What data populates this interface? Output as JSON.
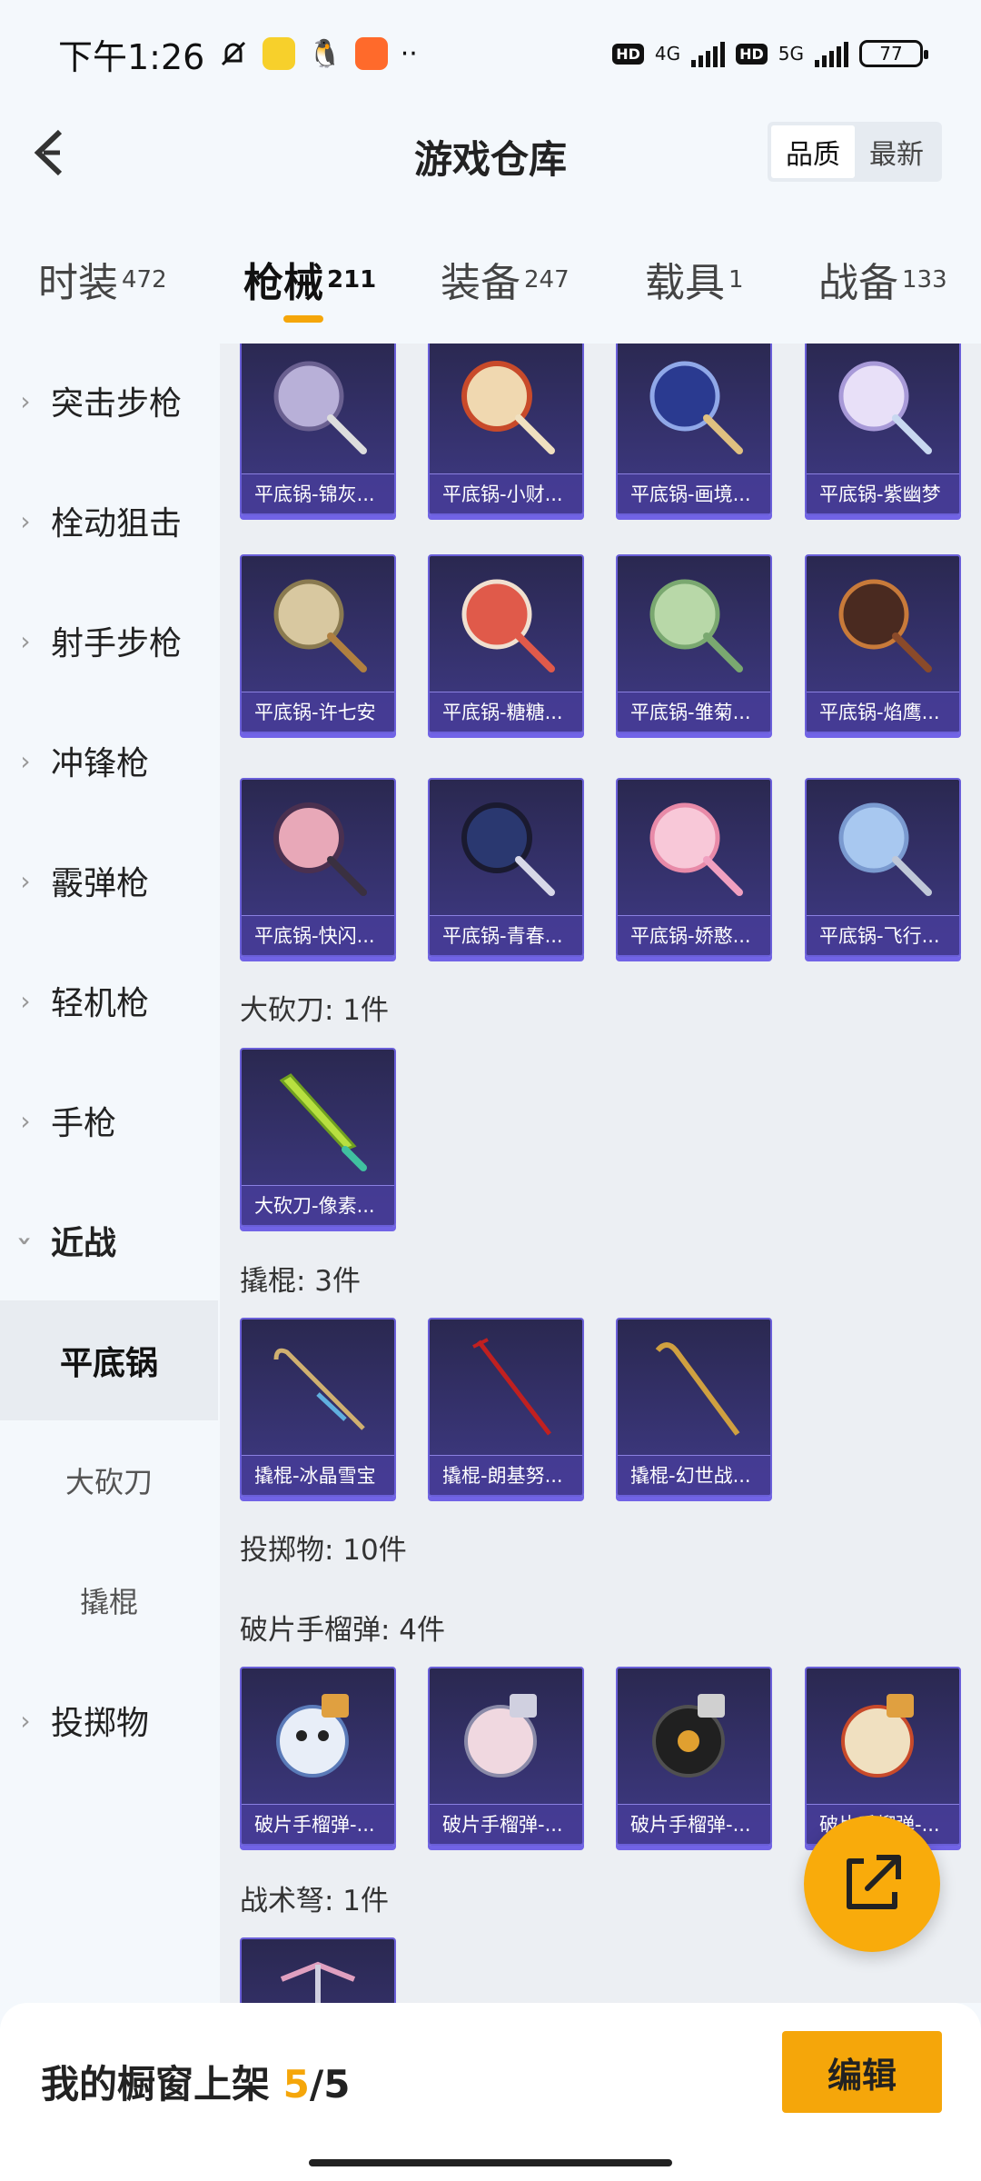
{
  "status_bar": {
    "time": "下午1:26",
    "net1": "4G",
    "net2": "5G",
    "hd": "HD",
    "battery": "77"
  },
  "header": {
    "title": "游戏仓库",
    "sort_quality": "品质",
    "sort_latest": "最新"
  },
  "tabs": [
    {
      "label": "时装",
      "count": "472"
    },
    {
      "label": "枪械",
      "count": "211"
    },
    {
      "label": "装备",
      "count": "247"
    },
    {
      "label": "载具",
      "count": "1"
    },
    {
      "label": "战备",
      "count": "133"
    }
  ],
  "sidebar": {
    "cat1": "突击步枪",
    "cat2": "栓动狙击",
    "cat3": "射手步枪",
    "cat4": "冲锋枪",
    "cat5": "霰弹枪",
    "cat6": "轻机枪",
    "cat7": "手枪",
    "cat8": "近战",
    "sub1": "平底锅",
    "sub2": "大砍刀",
    "sub3": "撬棍",
    "cat9": "投掷物"
  },
  "items": {
    "p1": "平底锅-锦灰...",
    "p2": "平底锅-小财...",
    "p3": "平底锅-画境...",
    "p4": "平底锅-紫幽梦",
    "p5": "平底锅-许七安",
    "p6": "平底锅-糖糖...",
    "p7": "平底锅-雏菊...",
    "p8": "平底锅-焰鹰...",
    "p9": "平底锅-快闪...",
    "p10": "平底锅-青春...",
    "p11": "平底锅-娇憨...",
    "p12": "平底锅-飞行...",
    "m1": "大砍刀-像素...",
    "c1": "撬棍-冰晶雪宝",
    "c2": "撬棍-朗基努...",
    "c3": "撬棍-幻世战...",
    "g1": "破片手榴弹-...",
    "g2": "破片手榴弹-...",
    "g3": "破片手榴弹-...",
    "g4": "破片手榴弹-..."
  },
  "sections": {
    "machete": "大砍刀: 1件",
    "crowbar": "撬棍: 3件",
    "throwable": "投掷物: 10件",
    "grenade": "破片手榴弹: 4件",
    "crossbow": "战术弩: 1件"
  },
  "footer": {
    "label": "我的橱窗上架 ",
    "count": "5",
    "total": "/5",
    "edit": "编辑"
  },
  "icons": {
    "back": "back-arrow-icon",
    "share": "share-external-icon"
  }
}
